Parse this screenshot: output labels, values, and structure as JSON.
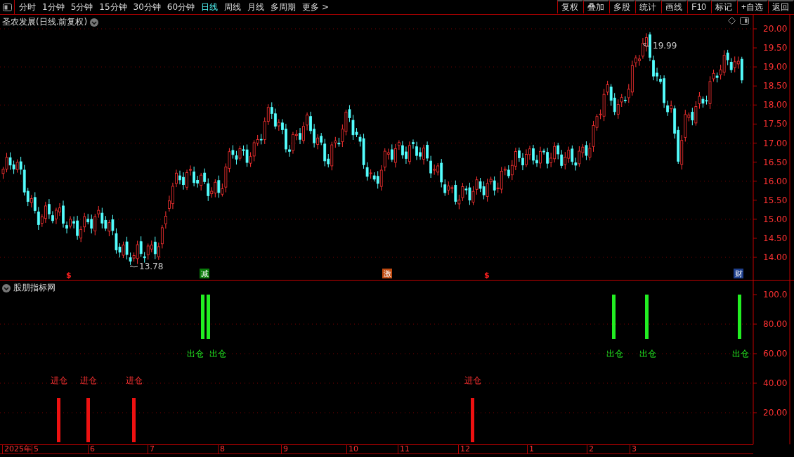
{
  "toolbar": {
    "periods": [
      {
        "label": "分时",
        "selected": false
      },
      {
        "label": "1分钟",
        "selected": false
      },
      {
        "label": "5分钟",
        "selected": false
      },
      {
        "label": "15分钟",
        "selected": false
      },
      {
        "label": "30分钟",
        "selected": false
      },
      {
        "label": "60分钟",
        "selected": false
      },
      {
        "label": "日线",
        "selected": true
      },
      {
        "label": "周线",
        "selected": false
      },
      {
        "label": "月线",
        "selected": false
      },
      {
        "label": "多周期",
        "selected": false
      }
    ],
    "more": "更多 >",
    "actions": [
      "复权",
      "叠加",
      "多股",
      "统计",
      "画线",
      "F10",
      "标记",
      "+自选",
      "返回"
    ]
  },
  "main_chart": {
    "title": "圣农发展(日线.前复权)",
    "price_ticks": [
      "20.00",
      "19.50",
      "19.00",
      "18.50",
      "18.00",
      "17.50",
      "17.00",
      "16.50",
      "16.00",
      "15.50",
      "15.00",
      "14.50",
      "14.00"
    ],
    "high_label": "19.99",
    "low_label": "13.78",
    "markers": [
      {
        "kind": "symbol",
        "text": "$"
      },
      {
        "kind": "tag",
        "text": "减",
        "color": "#0a7a0a"
      },
      {
        "kind": "tag",
        "text": "激",
        "color": "#c04a10"
      },
      {
        "kind": "symbol",
        "text": "$"
      },
      {
        "kind": "tag",
        "text": "财",
        "color": "#1e3f8c"
      }
    ]
  },
  "indicator": {
    "title": "股朋指标网",
    "ticks": [
      "100.0",
      "80.00",
      "60.00",
      "40.00",
      "20.00"
    ],
    "signals": [
      {
        "kind": "entry",
        "label": "进仓"
      },
      {
        "kind": "entry",
        "label": "进仓"
      },
      {
        "kind": "entry",
        "label": "进仓"
      },
      {
        "kind": "exit",
        "label": "出仓"
      },
      {
        "kind": "exit",
        "label": "出仓"
      },
      {
        "kind": "entry",
        "label": "进仓"
      },
      {
        "kind": "exit",
        "label": "出仓"
      },
      {
        "kind": "exit",
        "label": "出仓"
      },
      {
        "kind": "exit",
        "label": "出仓"
      }
    ]
  },
  "date_axis": {
    "labels": [
      "2025年",
      "5",
      "6",
      "7",
      "8",
      "9",
      "10",
      "11",
      "12",
      "1",
      "2",
      "3"
    ]
  }
}
